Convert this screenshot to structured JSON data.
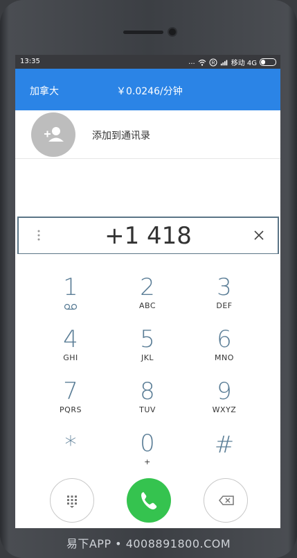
{
  "statusbar": {
    "time": "13:35",
    "dots": "...",
    "carrier": "移动 4G"
  },
  "topbar": {
    "country": "加拿大",
    "rate": "￥0.0246/分钟"
  },
  "contact": {
    "add_label": "添加到通讯录"
  },
  "dialer": {
    "number": "+1 418"
  },
  "keypad": {
    "keys": [
      {
        "digit": "1",
        "letters": ""
      },
      {
        "digit": "2",
        "letters": "ABC"
      },
      {
        "digit": "3",
        "letters": "DEF"
      },
      {
        "digit": "4",
        "letters": "GHI"
      },
      {
        "digit": "5",
        "letters": "JKL"
      },
      {
        "digit": "6",
        "letters": "MNO"
      },
      {
        "digit": "7",
        "letters": "PQRS"
      },
      {
        "digit": "8",
        "letters": "TUV"
      },
      {
        "digit": "9",
        "letters": "WXYZ"
      },
      {
        "digit": "*",
        "letters": ""
      },
      {
        "digit": "0",
        "letters": "+"
      },
      {
        "digit": "#",
        "letters": ""
      }
    ]
  },
  "colors": {
    "topbar": "#2b84e6",
    "call": "#35c34f",
    "digit": "#5a7d96"
  },
  "watermark": "易下APP • 4008891800.COM"
}
